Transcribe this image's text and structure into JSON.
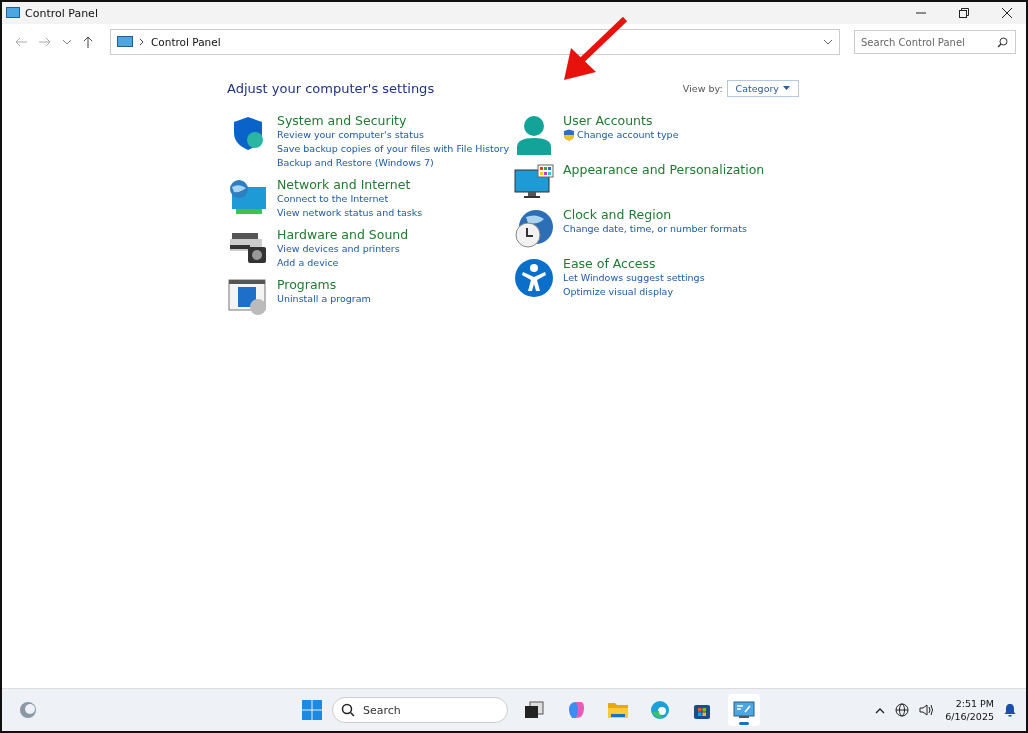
{
  "window": {
    "title": "Control Panel"
  },
  "address_bar": {
    "path": "Control Panel"
  },
  "search": {
    "placeholder": "Search Control Panel"
  },
  "heading": "Adjust your computer's settings",
  "view_by": {
    "label": "View by:",
    "value": "Category"
  },
  "columns": [
    [
      {
        "title": "System and Security",
        "links": [
          {
            "text": "Review your computer's status",
            "shield": false
          },
          {
            "text": "Save backup copies of your files with File History",
            "shield": false
          },
          {
            "text": "Backup and Restore (Windows 7)",
            "shield": false
          }
        ]
      },
      {
        "title": "Network and Internet",
        "links": [
          {
            "text": "Connect to the Internet",
            "shield": false
          },
          {
            "text": "View network status and tasks",
            "shield": false
          }
        ]
      },
      {
        "title": "Hardware and Sound",
        "links": [
          {
            "text": "View devices and printers",
            "shield": false
          },
          {
            "text": "Add a device",
            "shield": false
          }
        ]
      },
      {
        "title": "Programs",
        "links": [
          {
            "text": "Uninstall a program",
            "shield": false
          }
        ]
      }
    ],
    [
      {
        "title": "User Accounts",
        "links": [
          {
            "text": "Change account type",
            "shield": true
          }
        ]
      },
      {
        "title": "Appearance and Personalization"
      },
      {
        "title": "Clock and Region",
        "links": [
          {
            "text": "Change date, time, or number formats",
            "shield": false
          }
        ]
      },
      {
        "title": "Ease of Access",
        "links": [
          {
            "text": "Let Windows suggest settings",
            "shield": false
          },
          {
            "text": "Optimize visual display",
            "shield": false
          }
        ]
      }
    ]
  ],
  "taskbar": {
    "search_placeholder": "Search",
    "apps": [
      {
        "selected": false
      },
      {
        "selected": false
      },
      {
        "selected": false
      },
      {
        "selected": false
      },
      {
        "selected": false
      },
      {
        "selected": true
      }
    ],
    "time": "2:51 PM",
    "date": "6/16/2025"
  }
}
